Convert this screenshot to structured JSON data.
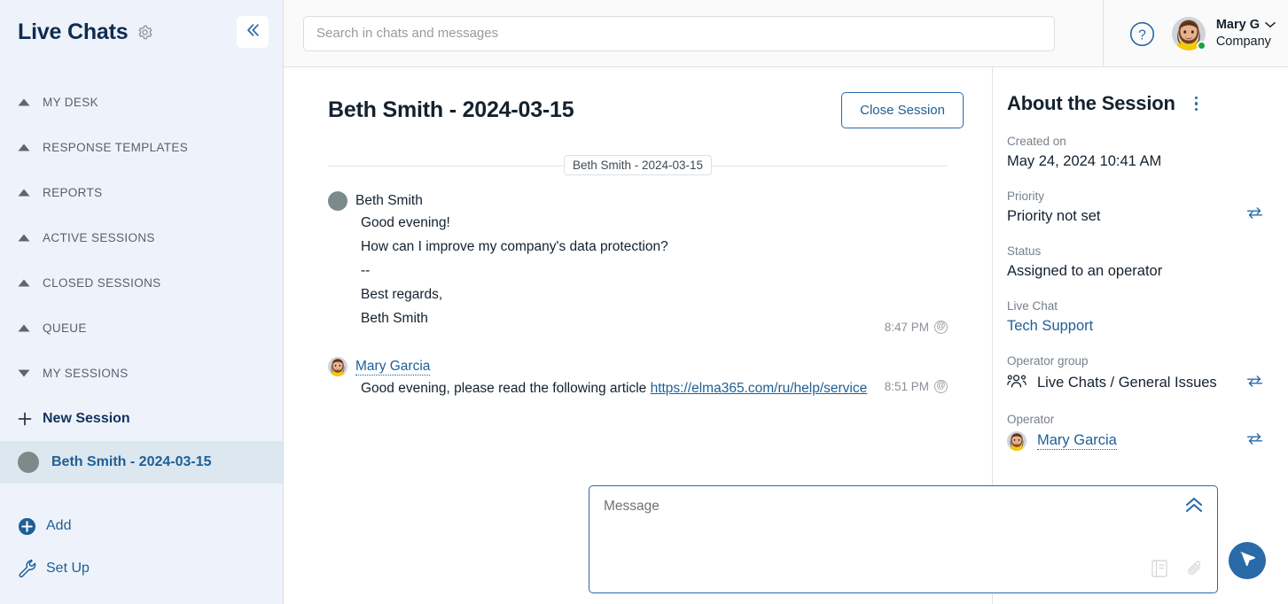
{
  "sidebar": {
    "title": "Live Chats",
    "gear_icon": "gear-icon",
    "collapse_icon": "double-chevron-left-icon",
    "nav_items": [
      {
        "label": "MY DESK",
        "caret": "caret-up-icon",
        "expanded": false
      },
      {
        "label": "RESPONSE TEMPLATES",
        "caret": "caret-up-icon",
        "expanded": false
      },
      {
        "label": "REPORTS",
        "caret": "caret-up-icon",
        "expanded": false
      },
      {
        "label": "ACTIVE SESSIONS",
        "caret": "caret-up-icon",
        "expanded": false
      },
      {
        "label": "CLOSED SESSIONS",
        "caret": "caret-up-icon",
        "expanded": false
      },
      {
        "label": "QUEUE",
        "caret": "caret-up-icon",
        "expanded": false
      },
      {
        "label": "MY SESSIONS",
        "caret": "caret-down-icon",
        "expanded": true
      }
    ],
    "new_session": {
      "label": "New Session",
      "icon": "plus-icon"
    },
    "sessions": [
      {
        "label": "Beth Smith - 2024-03-15",
        "selected": true,
        "status_color": "#7c8a8a"
      }
    ],
    "bottom_links": [
      {
        "label": "Add",
        "icon": "plus-circle-icon"
      },
      {
        "label": "Set Up",
        "icon": "wrench-icon"
      }
    ]
  },
  "topbar": {
    "search_placeholder": "Search in chats and messages",
    "search_value": "",
    "help_icon": "question-circle-icon",
    "user": {
      "name": "Mary G",
      "org": "Company",
      "status_color": "#1ea03c",
      "chevron": "chevron-down-icon"
    }
  },
  "chat": {
    "title": "Beth Smith - 2024-03-15",
    "close_button": "Close Session",
    "day_divider": "Beth Smith - 2024-03-15",
    "messages": [
      {
        "author": "Beth Smith",
        "author_is_link": false,
        "avatar_type": "circle",
        "lines": [
          "Good evening!",
          "How can I improve my company's data protection?",
          "--",
          "Best regards,",
          "Beth Smith"
        ],
        "time": "8:47 PM",
        "time_icon": "at-circle-icon"
      },
      {
        "author": "Mary Garcia",
        "author_is_link": true,
        "avatar_type": "photo",
        "text_prefix": "Good evening, please read the following article ",
        "link_text": "https://elma365.com/ru/help/service",
        "time": "8:51 PM",
        "time_icon": "at-circle-icon"
      }
    ],
    "composer": {
      "placeholder": "Message",
      "value": "",
      "expand_icon": "double-chevron-up-icon",
      "template_icon": "template-book-icon",
      "attach_icon": "paperclip-icon",
      "send_icon": "send-plane-icon"
    }
  },
  "right_panel": {
    "title": "About the Session",
    "menu_icon": "kebab-menu-icon",
    "fields": [
      {
        "label": "Created on",
        "value": "May 24, 2024 10:41 AM",
        "swap": false,
        "style": "plain"
      },
      {
        "label": "Priority",
        "value": "Priority not set",
        "swap": true,
        "style": "plain"
      },
      {
        "label": "Status",
        "value": "Assigned to an operator",
        "swap": false,
        "style": "plain"
      },
      {
        "label": "Live Chat",
        "value": "Tech Support",
        "swap": false,
        "style": "link"
      },
      {
        "label": "Operator group",
        "value": "Live Chats / General Issues",
        "swap": true,
        "style": "group",
        "icon": "people-group-icon"
      },
      {
        "label": "Operator",
        "value": "Mary Garcia",
        "swap": true,
        "style": "operator",
        "icon": "avatar"
      }
    ],
    "swap_icon": "transfer-arrows-icon"
  },
  "colors": {
    "accent_blue": "#2a6aa8",
    "link_blue": "#1e5f96",
    "sidebar_bg": "#eef3fb",
    "selected_bg": "#dce7ef",
    "online_green": "#1ea03c",
    "text_dark": "#14212e",
    "muted": "#77808a"
  }
}
